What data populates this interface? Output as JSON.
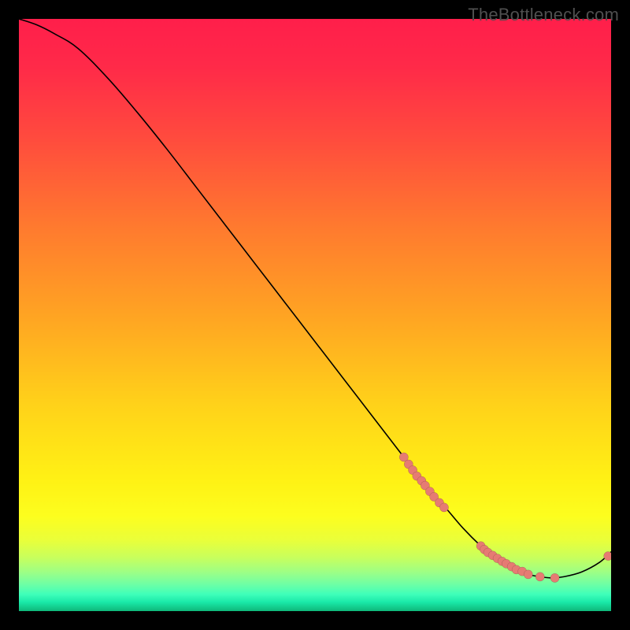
{
  "watermark": "TheBottleneck.com",
  "chart_data": {
    "type": "line",
    "title": "",
    "xlabel": "",
    "ylabel": "",
    "xlim": [
      0,
      100
    ],
    "ylim": [
      0,
      100
    ],
    "curve": {
      "x": [
        0,
        3,
        6,
        10,
        15,
        20,
        25,
        30,
        35,
        40,
        45,
        50,
        55,
        60,
        65,
        68,
        72,
        75,
        78,
        80,
        82,
        84,
        86,
        88,
        90,
        92,
        95,
        98,
        100
      ],
      "y": [
        100,
        99,
        97.5,
        95,
        90,
        84.2,
        78,
        71.5,
        65,
        58.5,
        52,
        45.5,
        39,
        32.5,
        26,
        22,
        17.5,
        14,
        11,
        9.4,
        8,
        7,
        6.2,
        5.8,
        5.6,
        5.8,
        6.6,
        8.2,
        10
      ]
    },
    "markers": {
      "x": [
        65.0,
        65.8,
        66.5,
        67.2,
        68.0,
        68.6,
        69.4,
        70.1,
        71.0,
        71.8,
        78.0,
        78.6,
        79.2,
        80.0,
        80.8,
        81.6,
        82.3,
        83.2,
        84.0,
        85.0,
        86.0,
        88.0,
        90.5,
        99.5
      ],
      "y": [
        26.0,
        24.8,
        23.8,
        22.8,
        22.0,
        21.2,
        20.2,
        19.3,
        18.3,
        17.5,
        11.0,
        10.4,
        9.9,
        9.4,
        8.9,
        8.4,
        8.0,
        7.5,
        7.0,
        6.7,
        6.2,
        5.8,
        5.6,
        9.3
      ]
    },
    "gradient_stops": [
      {
        "offset": 0.0,
        "color": "#ff1f4b"
      },
      {
        "offset": 0.08,
        "color": "#ff2a49"
      },
      {
        "offset": 0.2,
        "color": "#ff4b3e"
      },
      {
        "offset": 0.35,
        "color": "#ff7a2f"
      },
      {
        "offset": 0.5,
        "color": "#ffa423"
      },
      {
        "offset": 0.65,
        "color": "#ffd21a"
      },
      {
        "offset": 0.78,
        "color": "#fff215"
      },
      {
        "offset": 0.84,
        "color": "#fdfe1f"
      },
      {
        "offset": 0.88,
        "color": "#eaff3a"
      },
      {
        "offset": 0.91,
        "color": "#c8ff5e"
      },
      {
        "offset": 0.935,
        "color": "#9cff87"
      },
      {
        "offset": 0.955,
        "color": "#6effa6"
      },
      {
        "offset": 0.972,
        "color": "#3effba"
      },
      {
        "offset": 0.985,
        "color": "#1ae9a8"
      },
      {
        "offset": 1.0,
        "color": "#0fb87a"
      }
    ]
  }
}
